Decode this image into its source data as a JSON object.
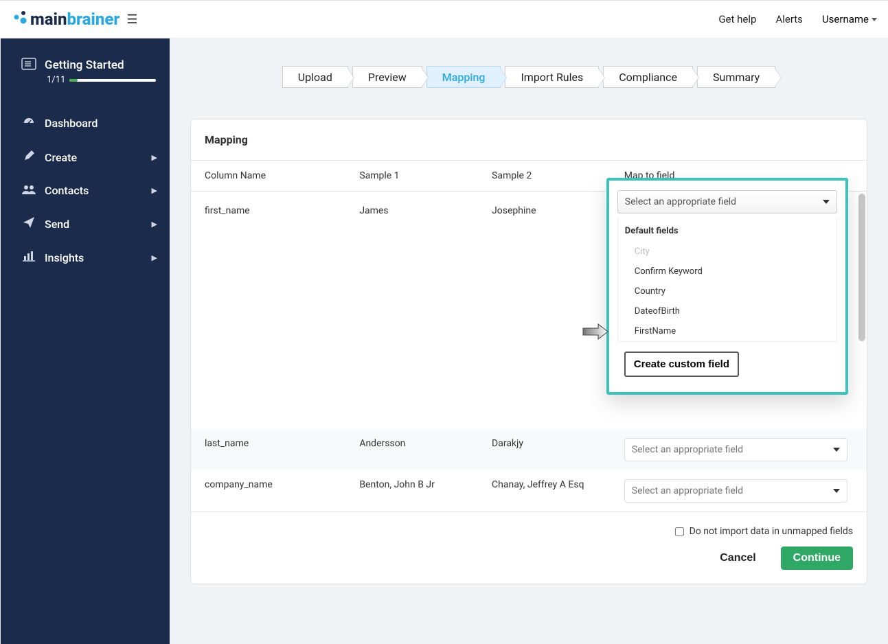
{
  "topbar": {
    "logo_main": "main",
    "logo_brainer": "brainer",
    "get_help": "Get help",
    "alerts": "Alerts",
    "username": "Username"
  },
  "sidebar": {
    "getting_started": {
      "title": "Getting Started",
      "progress_text": "1/11",
      "progress_pct": 9
    },
    "items": [
      {
        "label": "Dashboard",
        "icon": "dashboard-icon",
        "expandable": false
      },
      {
        "label": "Create",
        "icon": "create-icon",
        "expandable": true
      },
      {
        "label": "Contacts",
        "icon": "contacts-icon",
        "expandable": true
      },
      {
        "label": "Send",
        "icon": "send-icon",
        "expandable": true
      },
      {
        "label": "Insights",
        "icon": "insights-icon",
        "expandable": true
      }
    ]
  },
  "stepper": {
    "steps": [
      "Upload",
      "Preview",
      "Mapping",
      "Import Rules",
      "Compliance",
      "Summary"
    ],
    "active": "Mapping"
  },
  "mapping_card": {
    "title": "Mapping",
    "columns": [
      "Column Name",
      "Sample 1",
      "Sample 2",
      "Map to field"
    ],
    "select_placeholder": "Select an appropriate field",
    "rows": [
      {
        "column_name": "first_name",
        "sample1": "James",
        "sample2": "Josephine"
      },
      {
        "column_name": "last_name",
        "sample1": "Andersson",
        "sample2": "Darakjy"
      },
      {
        "column_name": "company_name",
        "sample1": "Benton, John B Jr",
        "sample2": "Chanay, Jeffrey A Esq"
      }
    ],
    "dropdown": {
      "section_label": "Default fields",
      "options": [
        {
          "label": "City",
          "disabled": true
        },
        {
          "label": "Confirm Keyword",
          "disabled": false
        },
        {
          "label": "Country",
          "disabled": false
        },
        {
          "label": "DateofBirth",
          "disabled": false
        },
        {
          "label": "FirstName",
          "disabled": false
        }
      ],
      "create_custom": "Create custom field"
    },
    "footer": {
      "checkbox_label": "Do not import data in unmapped fields",
      "cancel": "Cancel",
      "continue": "Continue"
    }
  }
}
